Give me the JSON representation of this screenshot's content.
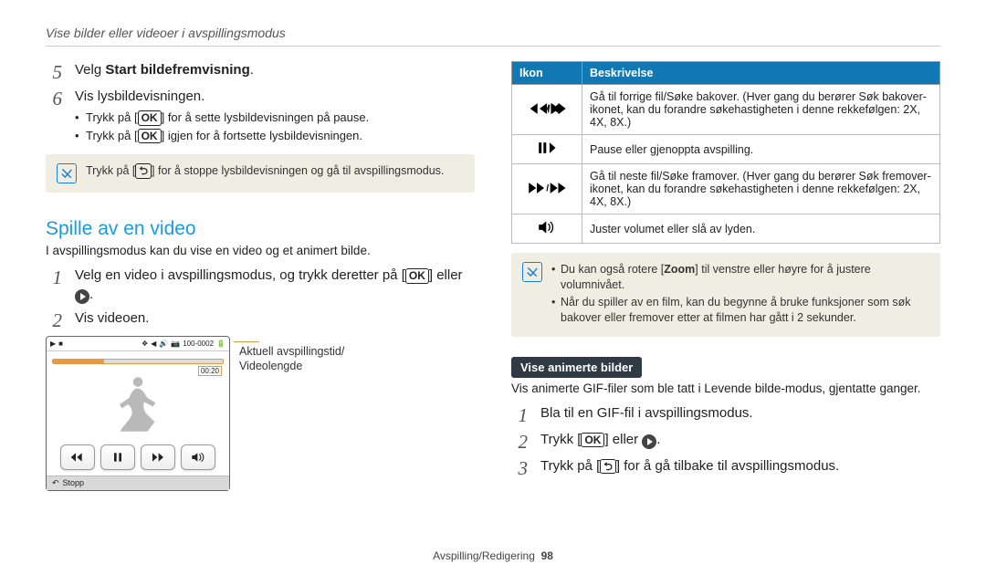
{
  "breadcrumb": "Vise bilder eller videoer i avspillingsmodus",
  "left": {
    "steps56": [
      {
        "n": "5",
        "pre": "Velg ",
        "bold": "Start bildefremvisning",
        "post": "."
      },
      {
        "n": "6",
        "pre": "Vis lysbildevisningen.",
        "bold": "",
        "post": ""
      }
    ],
    "bullets6": [
      "Trykk på [OK] for å sette lysbildevisningen på pause.",
      "Trykk på [OK] igjen for å fortsette lysbildevisningen."
    ],
    "note1": "Trykk på [↶] for å stoppe lysbildevisningen og gå til avspillingsmodus.",
    "sectionTitle": "Spille av en video",
    "sectionIntro": "I avspillingsmodus kan du vise en video og et animert bilde.",
    "steps12": [
      {
        "n": "1",
        "text": "Velg en video i avspillingsmodus, og trykk deretter på [OK] eller ▶."
      },
      {
        "n": "2",
        "text": "Vis videoen."
      }
    ],
    "video": {
      "counter": "100-0002",
      "clock": "00:20",
      "stopLabel": "Stopp"
    },
    "callout": "Aktuell avspillingstid/\nVideolengde"
  },
  "right": {
    "headers": {
      "c1": "Ikon",
      "c2": "Beskrivelse"
    },
    "rows": [
      {
        "id": "back",
        "desc": "Gå til forrige fil/Søke bakover. (Hver gang du berører Søk bakover-ikonet, kan du forandre søkehastigheten i denne rekkefølgen: 2X, 4X, 8X.)"
      },
      {
        "id": "pause",
        "desc": "Pause eller gjenoppta avspilling."
      },
      {
        "id": "fwd",
        "desc": "Gå til neste fil/Søke framover. (Hver gang du berører Søk fremover-ikonet, kan du forandre søkehastigheten i denne rekkefølgen: 2X, 4X, 8X.)"
      },
      {
        "id": "vol",
        "desc": "Juster volumet eller slå av lyden."
      }
    ],
    "note2": [
      "Du kan også rotere [Zoom] til venstre eller høyre for å justere volumnivået.",
      "Når du spiller av en film, kan du begynne å bruke funksjoner som søk bakover eller fremover etter at filmen har gått i 2 sekunder."
    ],
    "pill": "Vise animerte bilder",
    "pillIntro": "Vis animerte GIF-filer som ble tatt i Levende bilde-modus, gjentatte ganger.",
    "gifSteps": [
      {
        "n": "1",
        "text": "Bla til en GIF-fil i avspillingsmodus."
      },
      {
        "n": "2",
        "text": "Trykk [OK] eller ▶."
      },
      {
        "n": "3",
        "text": "Trykk på [↶] for å gå tilbake til avspillingsmodus."
      }
    ]
  },
  "footer": {
    "text": "Avspilling/Redigering",
    "page": "98"
  }
}
